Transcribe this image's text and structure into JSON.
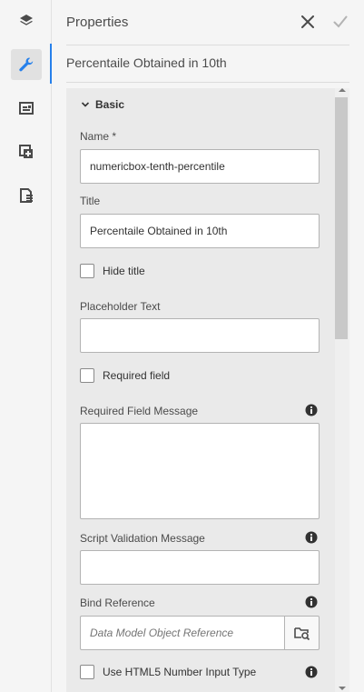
{
  "panel": {
    "title": "Properties",
    "subtitle": "Percentaile Obtained in 10th"
  },
  "rail": {
    "items": [
      {
        "icon": "layers-icon",
        "active": false
      },
      {
        "icon": "wrench-icon",
        "active": true
      },
      {
        "icon": "templates-icon",
        "active": false
      },
      {
        "icon": "add-components-icon",
        "active": false
      },
      {
        "icon": "content-tree-icon",
        "active": false
      }
    ]
  },
  "section": {
    "label": "Basic"
  },
  "form": {
    "name_label": "Name *",
    "name_value": "numericbox-tenth-percentile",
    "title_label": "Title",
    "title_value": "Percentaile Obtained in 10th",
    "hide_title_label": "Hide title",
    "placeholder_label": "Placeholder Text",
    "placeholder_value": "",
    "required_label": "Required field",
    "required_msg_label": "Required Field Message",
    "required_msg_value": "",
    "script_msg_label": "Script Validation Message",
    "script_msg_value": "",
    "bind_label": "Bind Reference",
    "bind_placeholder": "Data Model Object Reference",
    "html5_label": "Use HTML5 Number Input Type"
  },
  "colors": {
    "accent": "#2680eb",
    "panel_bg": "#f5f5f5",
    "section_bg": "#eaeaea"
  }
}
